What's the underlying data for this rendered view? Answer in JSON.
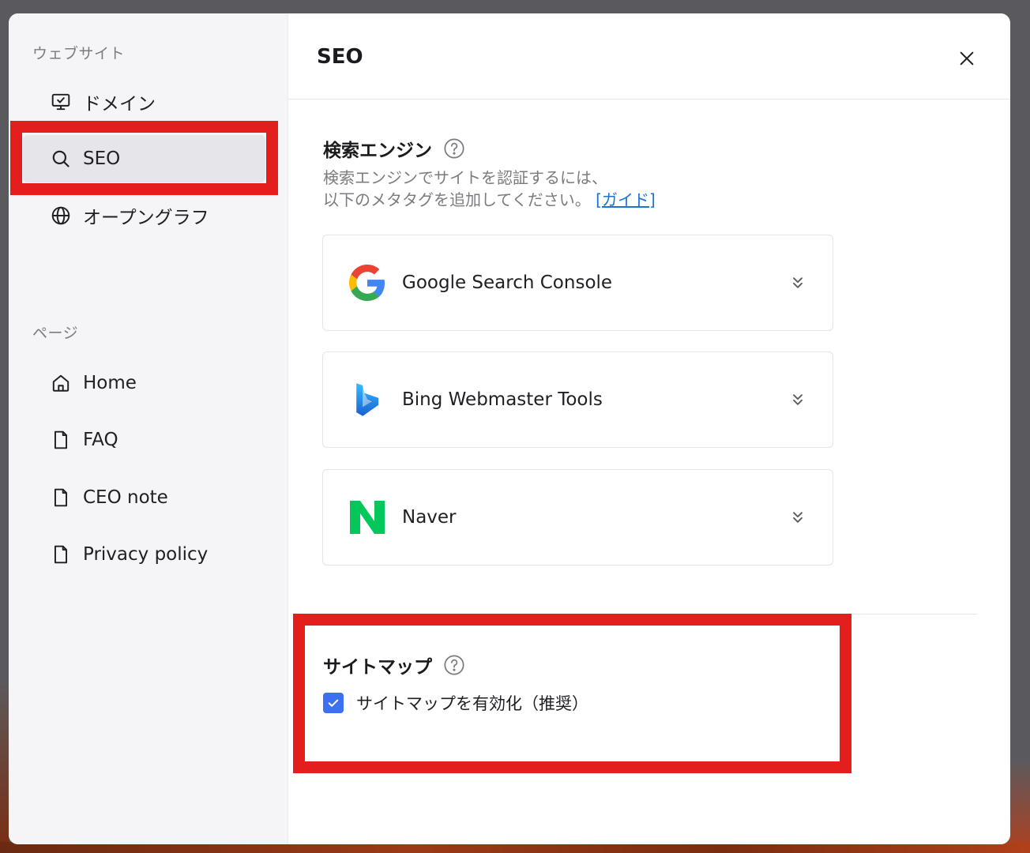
{
  "sidebar": {
    "website_label": "ウェブサイト",
    "website_items": [
      {
        "label": "ドメイン",
        "icon": "monitor-check-icon"
      },
      {
        "label": "SEO",
        "icon": "search-icon",
        "active": true
      },
      {
        "label": "オープングラフ",
        "icon": "globe-icon"
      }
    ],
    "pages_label": "ページ",
    "page_items": [
      {
        "label": "Home",
        "icon": "home-icon"
      },
      {
        "label": "FAQ",
        "icon": "document-icon"
      },
      {
        "label": "CEO note",
        "icon": "document-icon"
      },
      {
        "label": "Privacy policy",
        "icon": "document-icon"
      }
    ]
  },
  "main": {
    "title": "SEO",
    "search_engine": {
      "title": "検索エンジン",
      "desc_line1": "検索エンジンでサイトを認証するには、",
      "desc_line2": "以下のメタタグを追加してください。",
      "guide_link": "[ガイド]",
      "engines": [
        {
          "name": "Google Search Console",
          "icon": "google-logo"
        },
        {
          "name": "Bing Webmaster Tools",
          "icon": "bing-logo"
        },
        {
          "name": "Naver",
          "icon": "naver-logo"
        }
      ]
    },
    "sitemap": {
      "title": "サイトマップ",
      "checkbox_label": "サイトマップを有効化（推奨）",
      "checked": true
    }
  },
  "colors": {
    "highlight": "#e41d1d",
    "checkbox": "#3d6ff2",
    "link": "#1d72d8",
    "naver": "#03c75a"
  }
}
